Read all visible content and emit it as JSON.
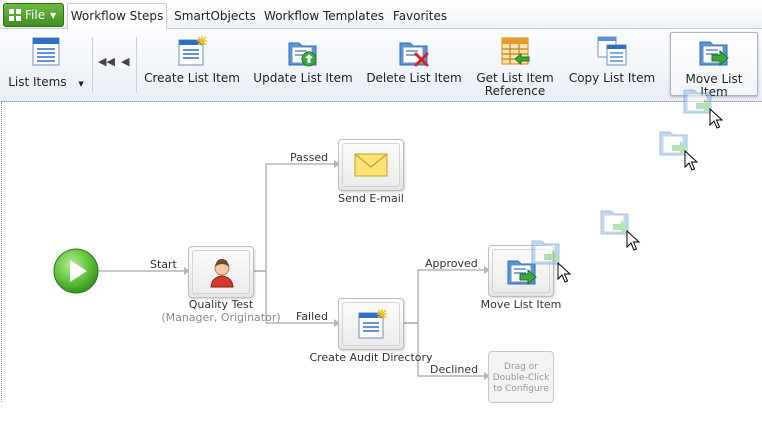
{
  "tabs": {
    "file": "File",
    "items": [
      {
        "label": "Workflow Steps",
        "active": true
      },
      {
        "label": "SmartObjects"
      },
      {
        "label": "Workflow Templates"
      },
      {
        "label": "Favorites"
      }
    ]
  },
  "ribbon": {
    "list_items": "List Items",
    "create_list_item": "Create List Item",
    "update_list_item": "Update List Item",
    "delete_list_item": "Delete List Item",
    "get_list_item_reference_1": "Get List Item",
    "get_list_item_reference_2": "Reference",
    "copy_list_item": "Copy List Item",
    "move_list_item": "Move List Item"
  },
  "workflow": {
    "start_label": "Start",
    "passed_label": "Passed",
    "failed_label": "Failed",
    "approved_label": "Approved",
    "declined_label": "Declined",
    "send_email": "Send E-mail",
    "quality_test": "Quality Test",
    "quality_test_sub": "(Manager, Originator)",
    "create_audit_directory": "Create Audit Directory",
    "move_list_item": "Move List Item",
    "placeholder_1": "Drag or",
    "placeholder_2": "Double-Click",
    "placeholder_3": "to Configure"
  },
  "colors": {
    "file_button": "#4a9a28",
    "start_circle": "#5cbf3a",
    "accent_blue": "#2f6fc6"
  }
}
